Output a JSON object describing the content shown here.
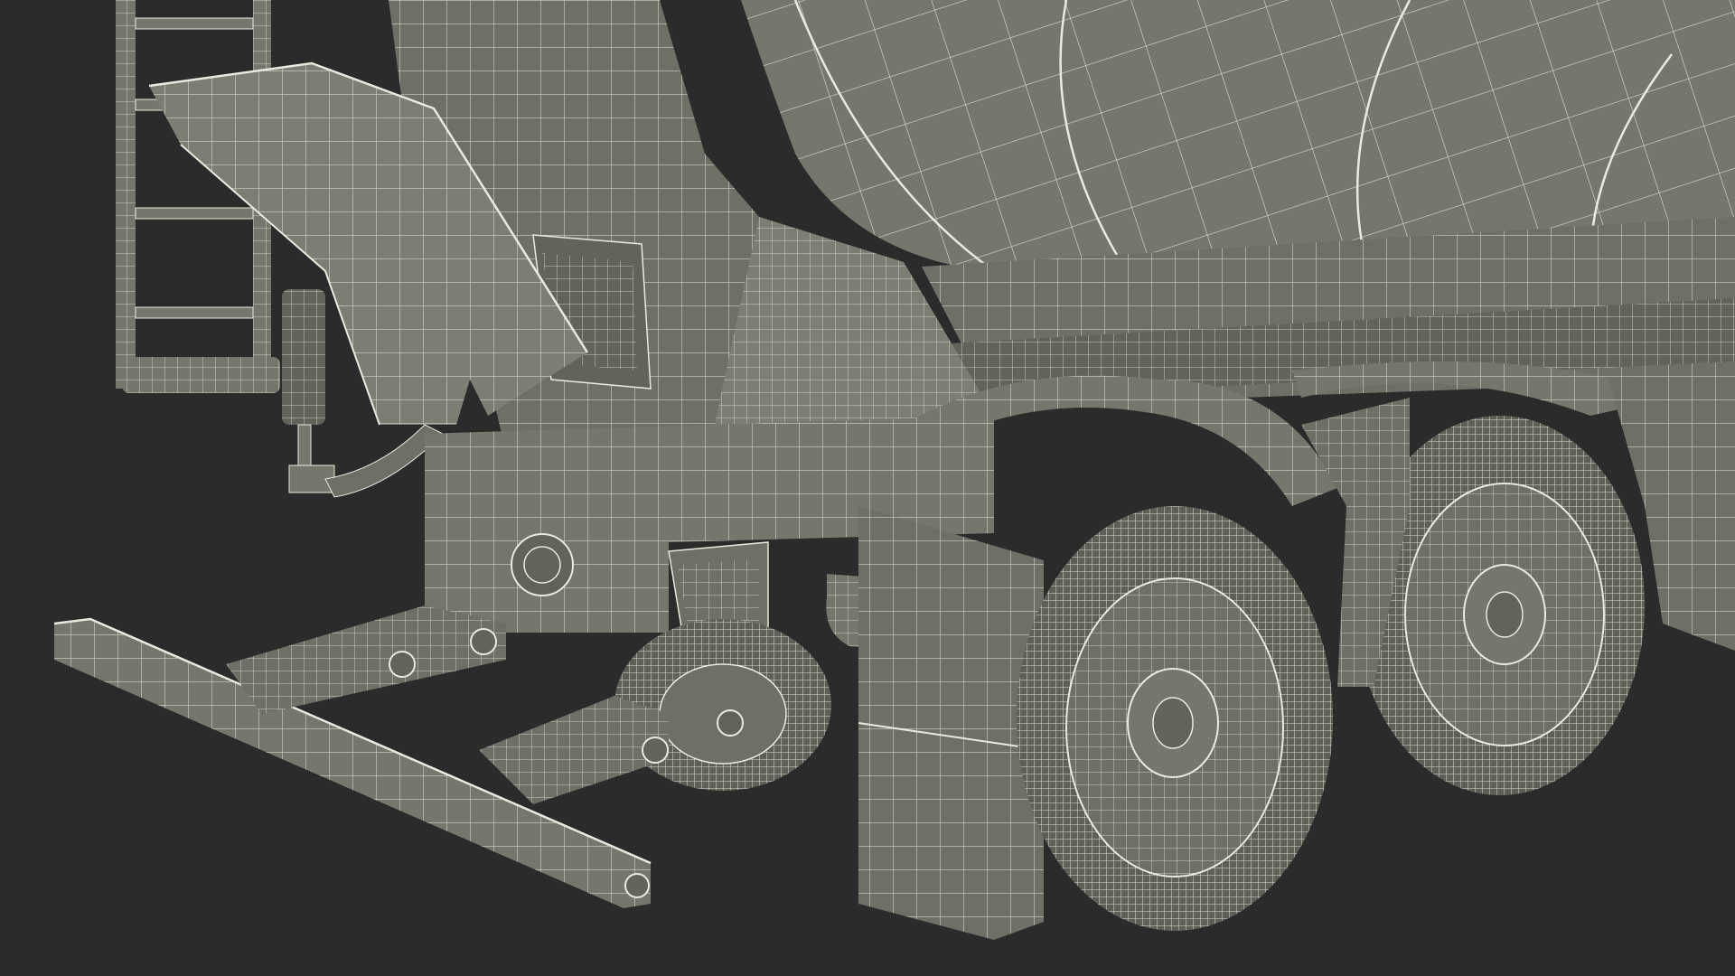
{
  "scene": {
    "subject": "concrete-mixer-truck-rear-wireframe",
    "colors": {
      "background": "#2b2b2b",
      "surface": "#75766c",
      "surface_dark": "#62635b",
      "surface_light": "#85867c",
      "wire": "#e9e9df",
      "tire": "#5e5f57",
      "chassis": "#6e6f66"
    }
  }
}
